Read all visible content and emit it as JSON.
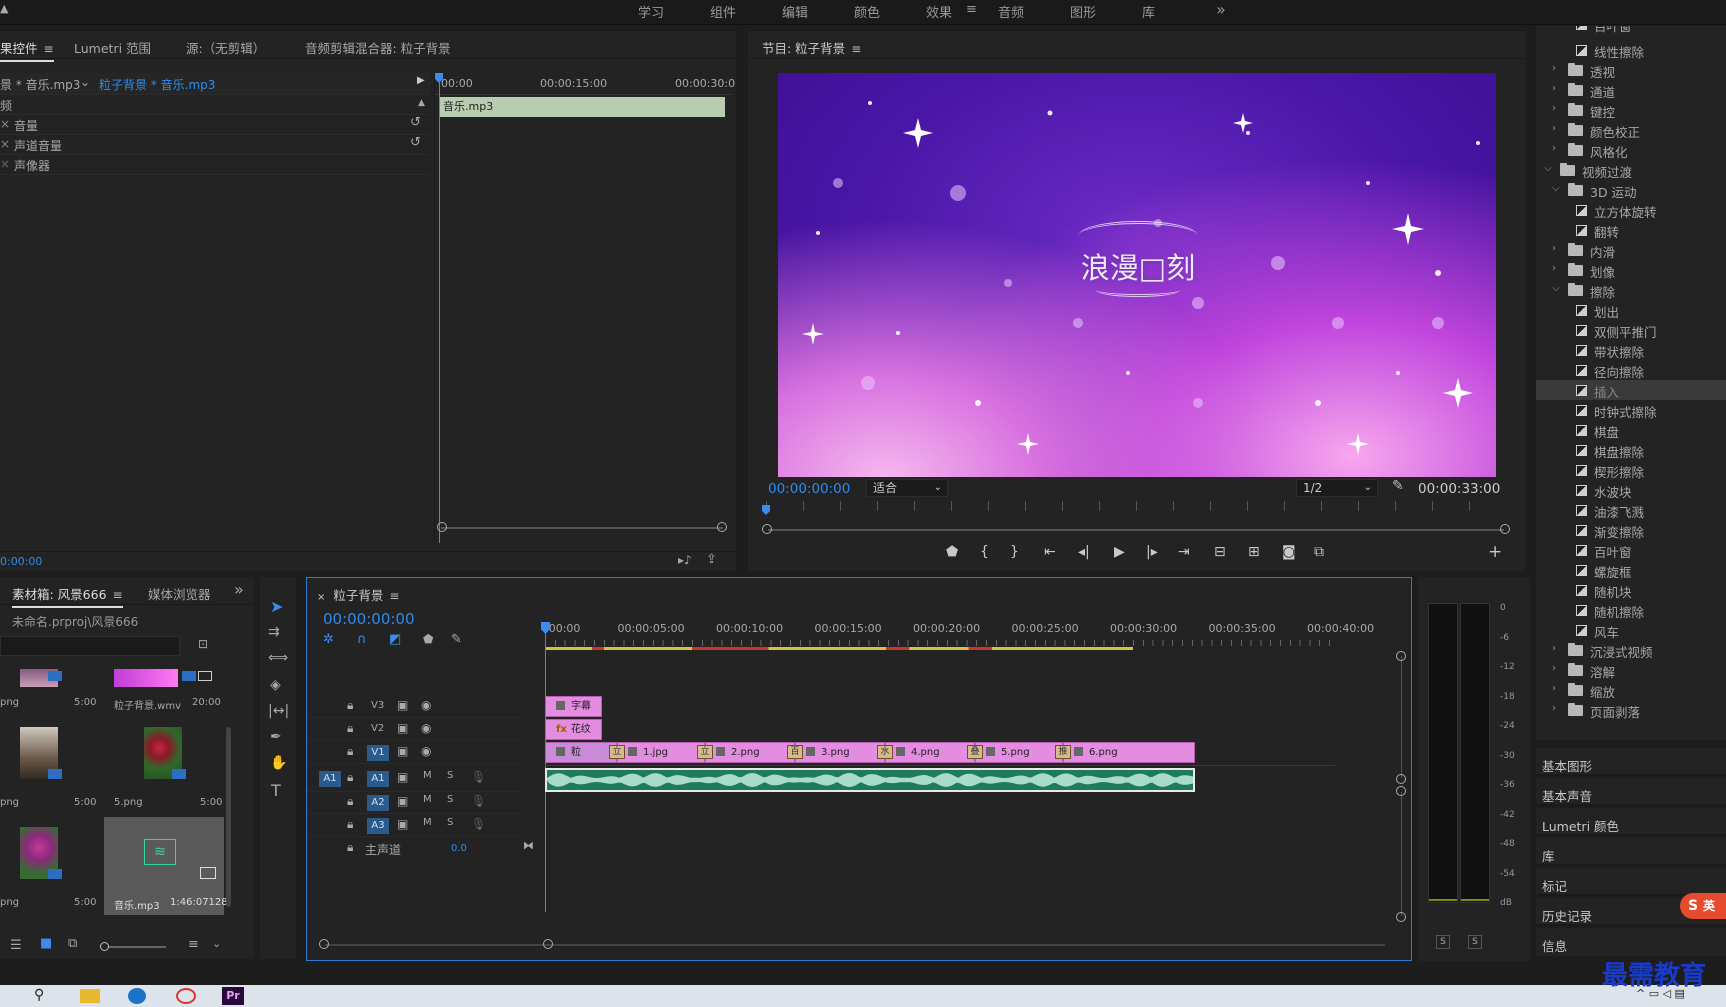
{
  "workspace_tabs": [
    "学习",
    "组件",
    "编辑",
    "颜色",
    "效果",
    "音频",
    "图形",
    "库"
  ],
  "workspace_active": "效果",
  "effect_controls": {
    "tabs": [
      "果控件",
      "Lumetri 范围",
      "源:（无剪辑）",
      "音频剪辑混合器: 粒子背景"
    ],
    "source_path": "景 * 音乐.mp3",
    "sequence_path": "粒子背景 * 音乐.mp3",
    "section_header": "频",
    "params": [
      "音量",
      "声道音量",
      "声像器"
    ],
    "ruler": [
      "00:00",
      "00:00:15:00",
      "00:00:30:0"
    ],
    "clip_name": "音乐.mp3",
    "timecode": "0:00:00"
  },
  "program_monitor": {
    "title": "节目: 粒子背景",
    "timecode": "00:00:00:00",
    "fit": "适合",
    "resolution": "1/2",
    "duration": "00:00:33:00",
    "overlay_text": "浪漫□刻"
  },
  "effects_tree": [
    {
      "label": "百叶窗",
      "level": 2,
      "kind": "fx"
    },
    {
      "label": "线性擦除",
      "level": 2,
      "kind": "fx"
    },
    {
      "label": "透视",
      "level": 1,
      "kind": "folder",
      "state": "closed"
    },
    {
      "label": "通道",
      "level": 1,
      "kind": "folder",
      "state": "closed"
    },
    {
      "label": "键控",
      "level": 1,
      "kind": "folder",
      "state": "closed"
    },
    {
      "label": "颜色校正",
      "level": 1,
      "kind": "folder",
      "state": "closed"
    },
    {
      "label": "风格化",
      "level": 1,
      "kind": "folder",
      "state": "closed"
    },
    {
      "label": "视频过渡",
      "level": 0,
      "kind": "folder",
      "state": "open"
    },
    {
      "label": "3D 运动",
      "level": 1,
      "kind": "folder",
      "state": "open"
    },
    {
      "label": "立方体旋转",
      "level": 2,
      "kind": "fx"
    },
    {
      "label": "翻转",
      "level": 2,
      "kind": "fx"
    },
    {
      "label": "内滑",
      "level": 1,
      "kind": "folder",
      "state": "closed"
    },
    {
      "label": "划像",
      "level": 1,
      "kind": "folder",
      "state": "closed"
    },
    {
      "label": "擦除",
      "level": 1,
      "kind": "folder",
      "state": "open"
    },
    {
      "label": "划出",
      "level": 2,
      "kind": "fx"
    },
    {
      "label": "双侧平推门",
      "level": 2,
      "kind": "fx"
    },
    {
      "label": "带状擦除",
      "level": 2,
      "kind": "fx"
    },
    {
      "label": "径向擦除",
      "level": 2,
      "kind": "fx"
    },
    {
      "label": "插入",
      "level": 2,
      "kind": "fx",
      "selected": true
    },
    {
      "label": "时钟式擦除",
      "level": 2,
      "kind": "fx"
    },
    {
      "label": "棋盘",
      "level": 2,
      "kind": "fx"
    },
    {
      "label": "棋盘擦除",
      "level": 2,
      "kind": "fx"
    },
    {
      "label": "楔形擦除",
      "level": 2,
      "kind": "fx"
    },
    {
      "label": "水波块",
      "level": 2,
      "kind": "fx"
    },
    {
      "label": "油漆飞溅",
      "level": 2,
      "kind": "fx"
    },
    {
      "label": "渐变擦除",
      "level": 2,
      "kind": "fx"
    },
    {
      "label": "百叶窗",
      "level": 2,
      "kind": "fx"
    },
    {
      "label": "螺旋框",
      "level": 2,
      "kind": "fx"
    },
    {
      "label": "随机块",
      "level": 2,
      "kind": "fx"
    },
    {
      "label": "随机擦除",
      "level": 2,
      "kind": "fx"
    },
    {
      "label": "风车",
      "level": 2,
      "kind": "fx"
    },
    {
      "label": "沉浸式视频",
      "level": 1,
      "kind": "folder",
      "state": "closed"
    },
    {
      "label": "溶解",
      "level": 1,
      "kind": "folder",
      "state": "closed"
    },
    {
      "label": "缩放",
      "level": 1,
      "kind": "folder",
      "state": "closed"
    },
    {
      "label": "页面剥落",
      "level": 1,
      "kind": "folder",
      "state": "closed"
    }
  ],
  "side_panels": [
    "基本图形",
    "基本声音",
    "Lumetri 颜色",
    "库",
    "标记",
    "历史记录",
    "信息"
  ],
  "project": {
    "tabs": [
      "素材箱: 风景666",
      "媒体浏览器"
    ],
    "path": "未命名.prproj\\风景666",
    "items": [
      {
        "name": "png",
        "dur": "5:00"
      },
      {
        "name": "粒子背景.wmv",
        "dur": "20:00"
      },
      {
        "name": "png",
        "dur": "5:00"
      },
      {
        "name": "5.png",
        "dur": "5:00"
      },
      {
        "name": "png",
        "dur": "5:00"
      },
      {
        "name": "音乐.mp3",
        "dur": "1:46:07128"
      }
    ]
  },
  "timeline": {
    "title": "粒子背景",
    "timecode": "00:00:00:00",
    "ruler": [
      ":00:00",
      "00:00:05:00",
      "00:00:10:00",
      "00:00:15:00",
      "00:00:20:00",
      "00:00:25:00",
      "00:00:30:00",
      "00:00:35:00",
      "00:00:40:00"
    ],
    "video_tracks": [
      "V3",
      "V2",
      "V1"
    ],
    "audio_tracks": [
      "A1",
      "A2",
      "A3"
    ],
    "source_patch": "A1",
    "master": "主声道",
    "master_value": "0.0",
    "v3_clip": "字幕",
    "v2_clip": "花纹",
    "v1_clips": [
      "粒",
      "1.jpg",
      "2.png",
      "3.png",
      "4.png",
      "5.png",
      "6.png"
    ],
    "transition_marks": [
      "立",
      "立",
      "百",
      "水",
      "叠",
      "推"
    ]
  },
  "meter": {
    "scale": [
      "0",
      "-6",
      "-12",
      "-18",
      "-24",
      "-30",
      "-36",
      "-42",
      "-48",
      "-54",
      "dB"
    ],
    "solo": [
      "S",
      "S"
    ]
  },
  "watermark": "最需教育",
  "ime_badge": "英"
}
